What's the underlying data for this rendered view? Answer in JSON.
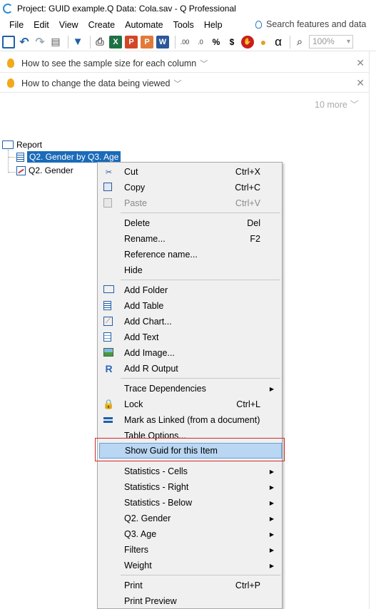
{
  "window": {
    "title": "Project: GUID example.Q  Data: Cola.sav - Q Professional"
  },
  "menubar": {
    "items": [
      "File",
      "Edit",
      "View",
      "Create",
      "Automate",
      "Tools",
      "Help"
    ],
    "search_placeholder": "Search features and data"
  },
  "toolbar": {
    "excel": "X",
    "ppt": "P",
    "pptb": "P",
    "word": "W",
    "dec_increase": ".00",
    "dec_decrease": ".0",
    "percent": "%",
    "dollar": "$",
    "alpha": "α",
    "zoom": "100%"
  },
  "tips": [
    {
      "text": "How to see the sample size for each column"
    },
    {
      "text": "How to change the data being viewed"
    }
  ],
  "tips_more": "10 more",
  "tree": {
    "root": "Report",
    "items": [
      "Q2. Gender by Q3. Age",
      "Q2. Gender"
    ]
  },
  "context_menu": {
    "items": [
      {
        "label": "Cut",
        "shortcut": "Ctrl+X",
        "icon": "scissors-icon"
      },
      {
        "label": "Copy",
        "shortcut": "Ctrl+C",
        "icon": "copy-icon"
      },
      {
        "label": "Paste",
        "shortcut": "Ctrl+V",
        "icon": "paste-icon",
        "disabled": true
      },
      {
        "label": "Delete",
        "shortcut": "Del"
      },
      {
        "label": "Rename...",
        "shortcut": "F2"
      },
      {
        "label": "Reference name..."
      },
      {
        "label": "Hide"
      },
      {
        "label": "Add Folder",
        "icon": "folder-book-icon"
      },
      {
        "label": "Add Table",
        "icon": "table-icon"
      },
      {
        "label": "Add Chart...",
        "icon": "chart-icon"
      },
      {
        "label": "Add Text",
        "icon": "text-icon"
      },
      {
        "label": "Add Image...",
        "icon": "image-icon"
      },
      {
        "label": "Add R Output",
        "icon": "r-icon"
      },
      {
        "label": "Trace Dependencies",
        "submenu": true
      },
      {
        "label": "Lock",
        "shortcut": "Ctrl+L",
        "icon": "lock-icon"
      },
      {
        "label": "Mark as Linked (from a document)",
        "icon": "link-icon"
      },
      {
        "label": "Table Options..."
      },
      {
        "label": "Show Guid for this Item",
        "highlighted": true
      },
      {
        "label": "Statistics - Cells",
        "submenu": true
      },
      {
        "label": "Statistics - Right",
        "submenu": true
      },
      {
        "label": "Statistics - Below",
        "submenu": true
      },
      {
        "label": "Q2. Gender",
        "submenu": true
      },
      {
        "label": "Q3. Age",
        "submenu": true
      },
      {
        "label": "Filters",
        "submenu": true
      },
      {
        "label": "Weight",
        "submenu": true
      },
      {
        "label": "Print",
        "shortcut": "Ctrl+P"
      },
      {
        "label": "Print Preview"
      }
    ]
  },
  "colors": {
    "highlight": "#b9d6f2",
    "selection": "#1a6bb8",
    "annotation_box": "#d42a2a"
  }
}
